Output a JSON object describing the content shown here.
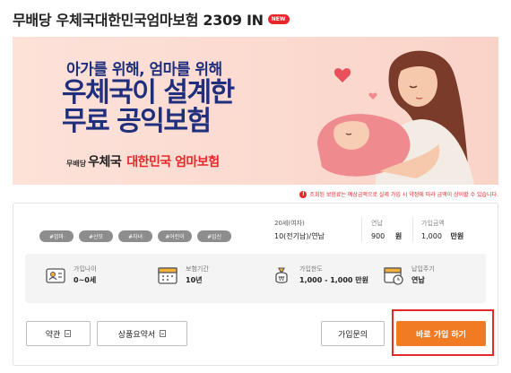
{
  "header": {
    "title": "무배당 우체국대한민국엄마보험 2309 IN",
    "new_badge": "NEW"
  },
  "banner": {
    "line1": "아가를 위해, 엄마를 위해",
    "line2": "우체국이 설계한",
    "line3": "무료 공익보험",
    "brand_small": "무배당",
    "brand_post": "우체국",
    "brand_product": "대한민국 엄마보험"
  },
  "notice": {
    "icon": "!",
    "text": "조회된 보험료는 예상금액으로 실제 가입 시 약정에 따라 금액이 상이할 수 있습니다."
  },
  "tags": [
    "#엄마",
    "#산모",
    "#자녀",
    "#어린이",
    "#임신"
  ],
  "conditions": {
    "top": "20세(여자)",
    "bottom": "10(전기납)/연납"
  },
  "payment": {
    "cycle_label": "연납",
    "cycle_amount": "900",
    "cycle_unit": "원",
    "subscription_label": "가입금액",
    "subscription_amount": "1,000",
    "subscription_unit": "만원"
  },
  "info": [
    {
      "label": "가입나이",
      "value": "0~0세",
      "icon": "person-card-icon"
    },
    {
      "label": "보험기간",
      "value": "10년",
      "icon": "calendar-icon"
    },
    {
      "label": "가입한도",
      "value": "1,000 - 1,000 만원",
      "icon": "money-bag-icon"
    },
    {
      "label": "납입주기",
      "value": "연납",
      "icon": "calendar-clock-icon"
    }
  ],
  "buttons": {
    "terms": "약관",
    "summary": "상품요약서",
    "inquiry": "가입문의",
    "join": "바로 가입 하기"
  },
  "colors": {
    "brand_navy": "#1f2f7d",
    "accent_red": "#e8272b",
    "cta_orange": "#f07b22"
  }
}
